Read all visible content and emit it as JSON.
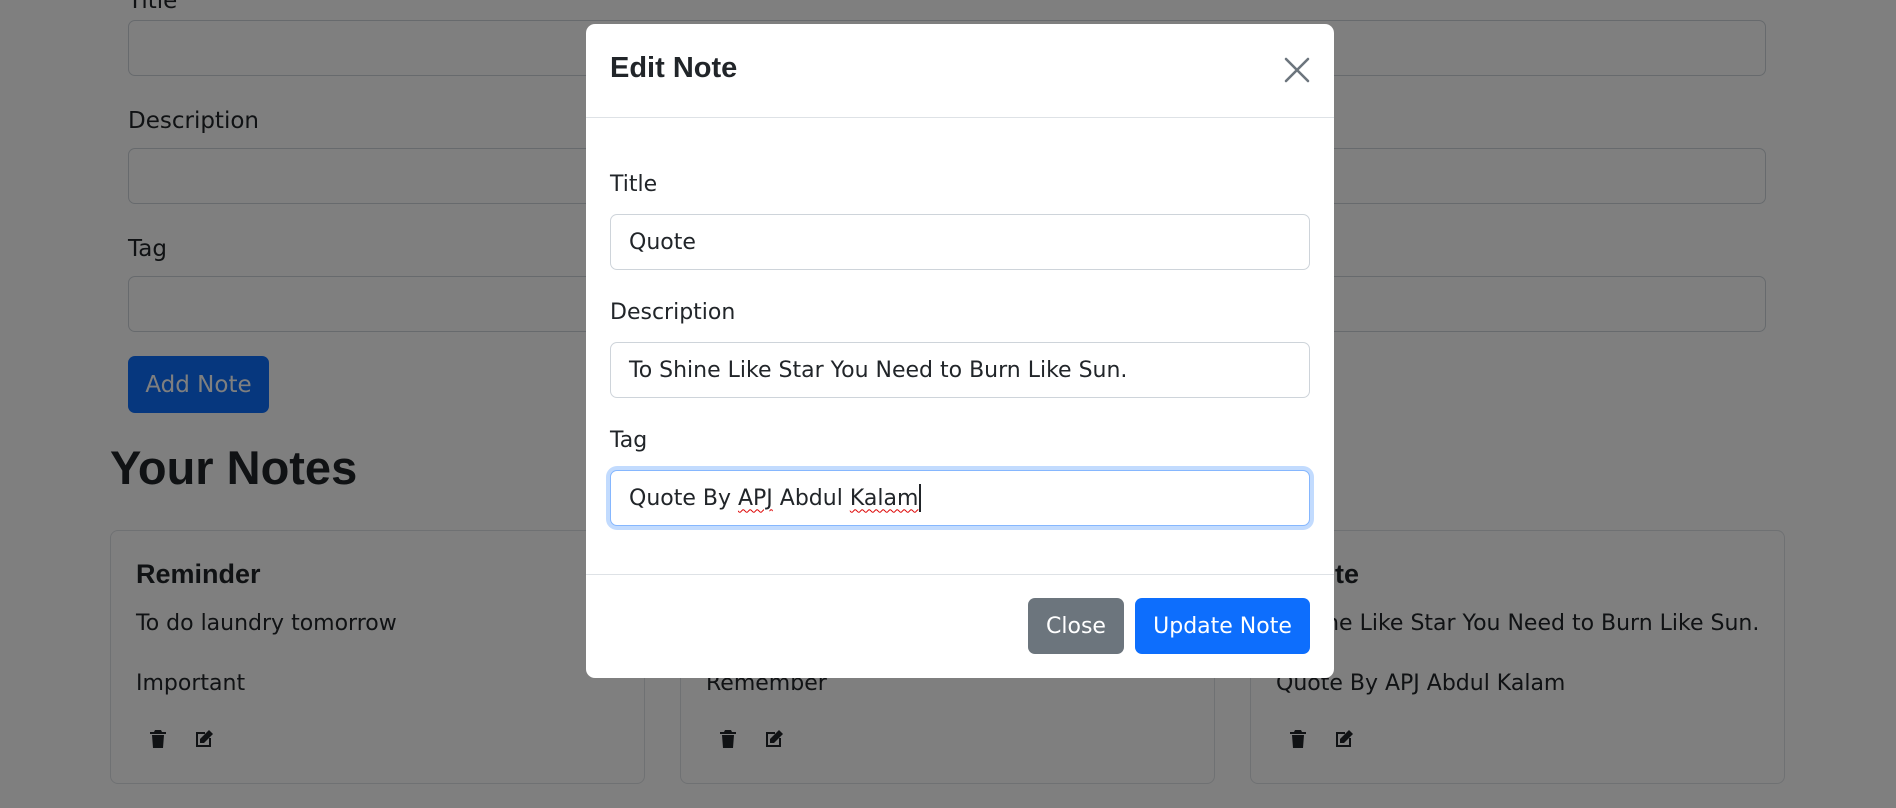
{
  "background": {
    "form": {
      "title_label": "Title",
      "description_label": "Description",
      "tag_label": "Tag",
      "add_button": "Add Note"
    },
    "notes_heading": "Your Notes",
    "notes": [
      {
        "title": "Reminder",
        "description": "To do laundry tomorrow",
        "tag": "Important"
      },
      {
        "title": "",
        "description": "",
        "tag": "Remember"
      },
      {
        "title": "te",
        "description": "ine Like Star You Need to Burn Like Sun.",
        "tag": "Quote By APJ Abdul Kalam"
      }
    ]
  },
  "modal": {
    "title": "Edit Note",
    "fields": {
      "title_label": "Title",
      "title_value": "Quote",
      "description_label": "Description",
      "description_value": "To Shine Like Star You Need to Burn Like Sun.",
      "tag_label": "Tag",
      "tag_value_parts": [
        "Quote By ",
        "APJ",
        " Abdul ",
        "Kalam"
      ]
    },
    "close_button": "Close",
    "update_button": "Update Note"
  },
  "icons": [
    "close-icon",
    "trash-icon",
    "edit-icon"
  ],
  "colors": {
    "primary": "#0d6efd",
    "secondary": "#6c757d",
    "backdrop": "rgba(0,0,0,0.5)"
  }
}
